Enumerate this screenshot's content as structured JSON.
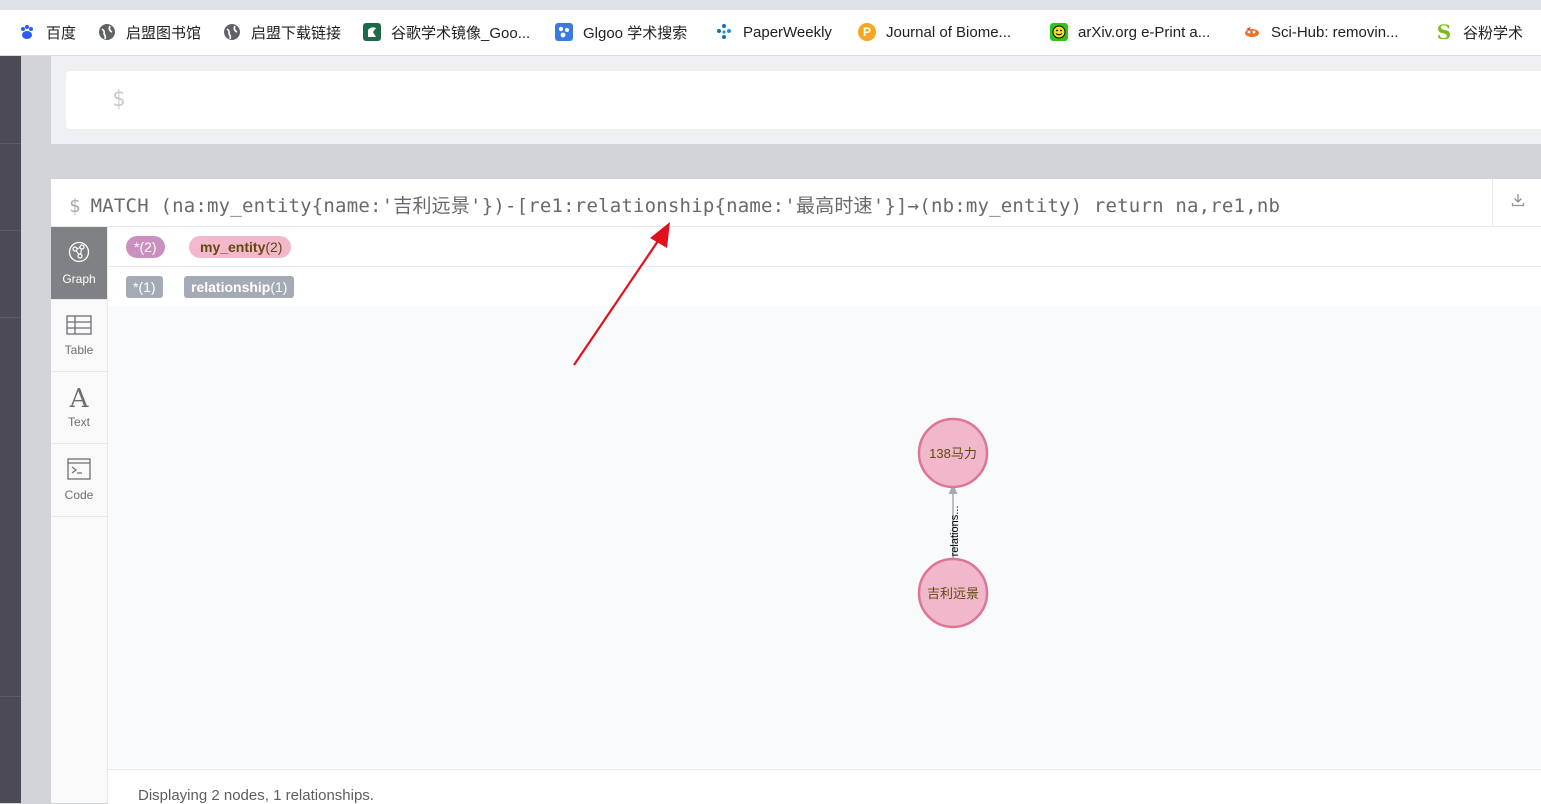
{
  "bookmarks": [
    {
      "label": "百度",
      "icon": "baidu-paw-icon",
      "color": "#2b5ef0"
    },
    {
      "label": "启盟图书馆",
      "icon": "globe-icon",
      "color": "#5f6368"
    },
    {
      "label": "启盟下载链接",
      "icon": "globe-icon",
      "color": "#5f6368"
    },
    {
      "label": "谷歌学术镜像_Goo...",
      "icon": "scholar-mirror-icon",
      "color": "#1e6b4a"
    },
    {
      "label": "Glgoo 学术搜索",
      "icon": "glgoo-icon",
      "color": "#3a7be0"
    },
    {
      "label": "PaperWeekly",
      "icon": "paperweekly-icon",
      "color": "#1b6ca8"
    },
    {
      "label": "Journal of Biome...",
      "icon": "journal-p-icon",
      "color": "#f5a623"
    },
    {
      "label": "arXiv.org e-Print a...",
      "icon": "smiley-icon",
      "color": "#34c21c"
    },
    {
      "label": "Sci-Hub: removin...",
      "icon": "raven-icon",
      "color": "#e8742a"
    },
    {
      "label": "谷粉学术",
      "icon": "gufen-s-icon",
      "color": "#7dbb1f"
    }
  ],
  "editor": {
    "prompt": "$"
  },
  "frame": {
    "prompt": "$",
    "query": "MATCH (na:my_entity{name:'吉利远景'})-[re1:relationship{name:'最高时速'}]→(nb:my_entity) return na,re1,nb"
  },
  "sidenav": [
    {
      "label": "Graph",
      "icon": "graph-icon",
      "active": true
    },
    {
      "label": "Table",
      "icon": "table-icon",
      "active": false
    },
    {
      "label": "Text",
      "icon": "text-icon",
      "active": false
    },
    {
      "label": "Code",
      "icon": "code-icon",
      "active": false
    }
  ],
  "legend": {
    "nodes": [
      {
        "name": "*",
        "count": "(2)"
      },
      {
        "name": "my_entity",
        "count": "(2)"
      }
    ],
    "relationships": [
      {
        "name": "*",
        "count": "(1)"
      },
      {
        "name": "relationship",
        "count": "(1)"
      }
    ]
  },
  "graph": {
    "nodes": [
      {
        "label": "138马力",
        "fill": "#f0b8ca",
        "stroke": "#de7496",
        "text_color": "#604a0e"
      },
      {
        "label": "吉利远景",
        "fill": "#f0b8ca",
        "stroke": "#de7496",
        "text_color": "#604a0e"
      }
    ],
    "relationship": {
      "label": "relations...",
      "color": "#a5abb6"
    }
  },
  "annotation": {
    "arrow_color": "#e0101e"
  },
  "status": "Displaying 2 nodes, 1 relationships.",
  "colors": {
    "sidebar": "#4b4a55",
    "active_tab": "#808184"
  }
}
